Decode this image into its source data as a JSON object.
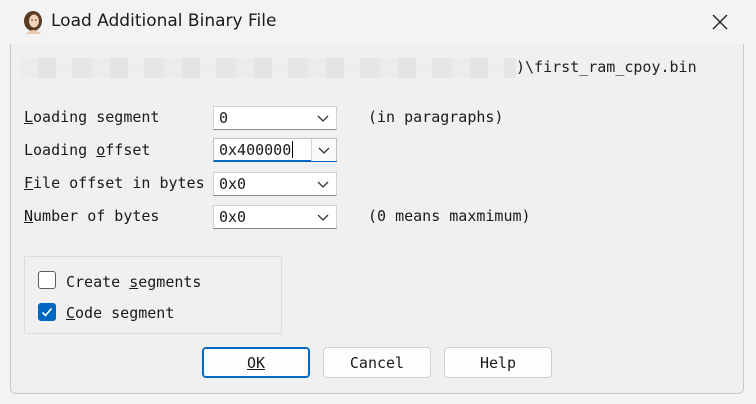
{
  "window": {
    "title": "Load Additional Binary File",
    "icon": "portrait-app-icon",
    "close_icon": "close-icon"
  },
  "file_path": {
    "visible_suffix": ")\\first_ram_cpoy.bin"
  },
  "fields": {
    "loading_segment": {
      "label": "Loading segment",
      "value": "0",
      "hint": "(in paragraphs)"
    },
    "loading_offset": {
      "label": "Loading offset",
      "value": "0x400000"
    },
    "file_offset": {
      "label": "File offset in bytes",
      "value": "0x0"
    },
    "number_of_bytes": {
      "label": "Number of bytes",
      "value": "0x0",
      "hint": "(0 means maxmimum)"
    }
  },
  "options": {
    "create_segments": {
      "label": "Create segments",
      "checked": false
    },
    "code_segment": {
      "label": "Code segment",
      "checked": true
    }
  },
  "buttons": {
    "ok": "OK",
    "cancel": "Cancel",
    "help": "Help"
  },
  "colors": {
    "accent": "#0067c0",
    "background": "#f0f0f0"
  }
}
